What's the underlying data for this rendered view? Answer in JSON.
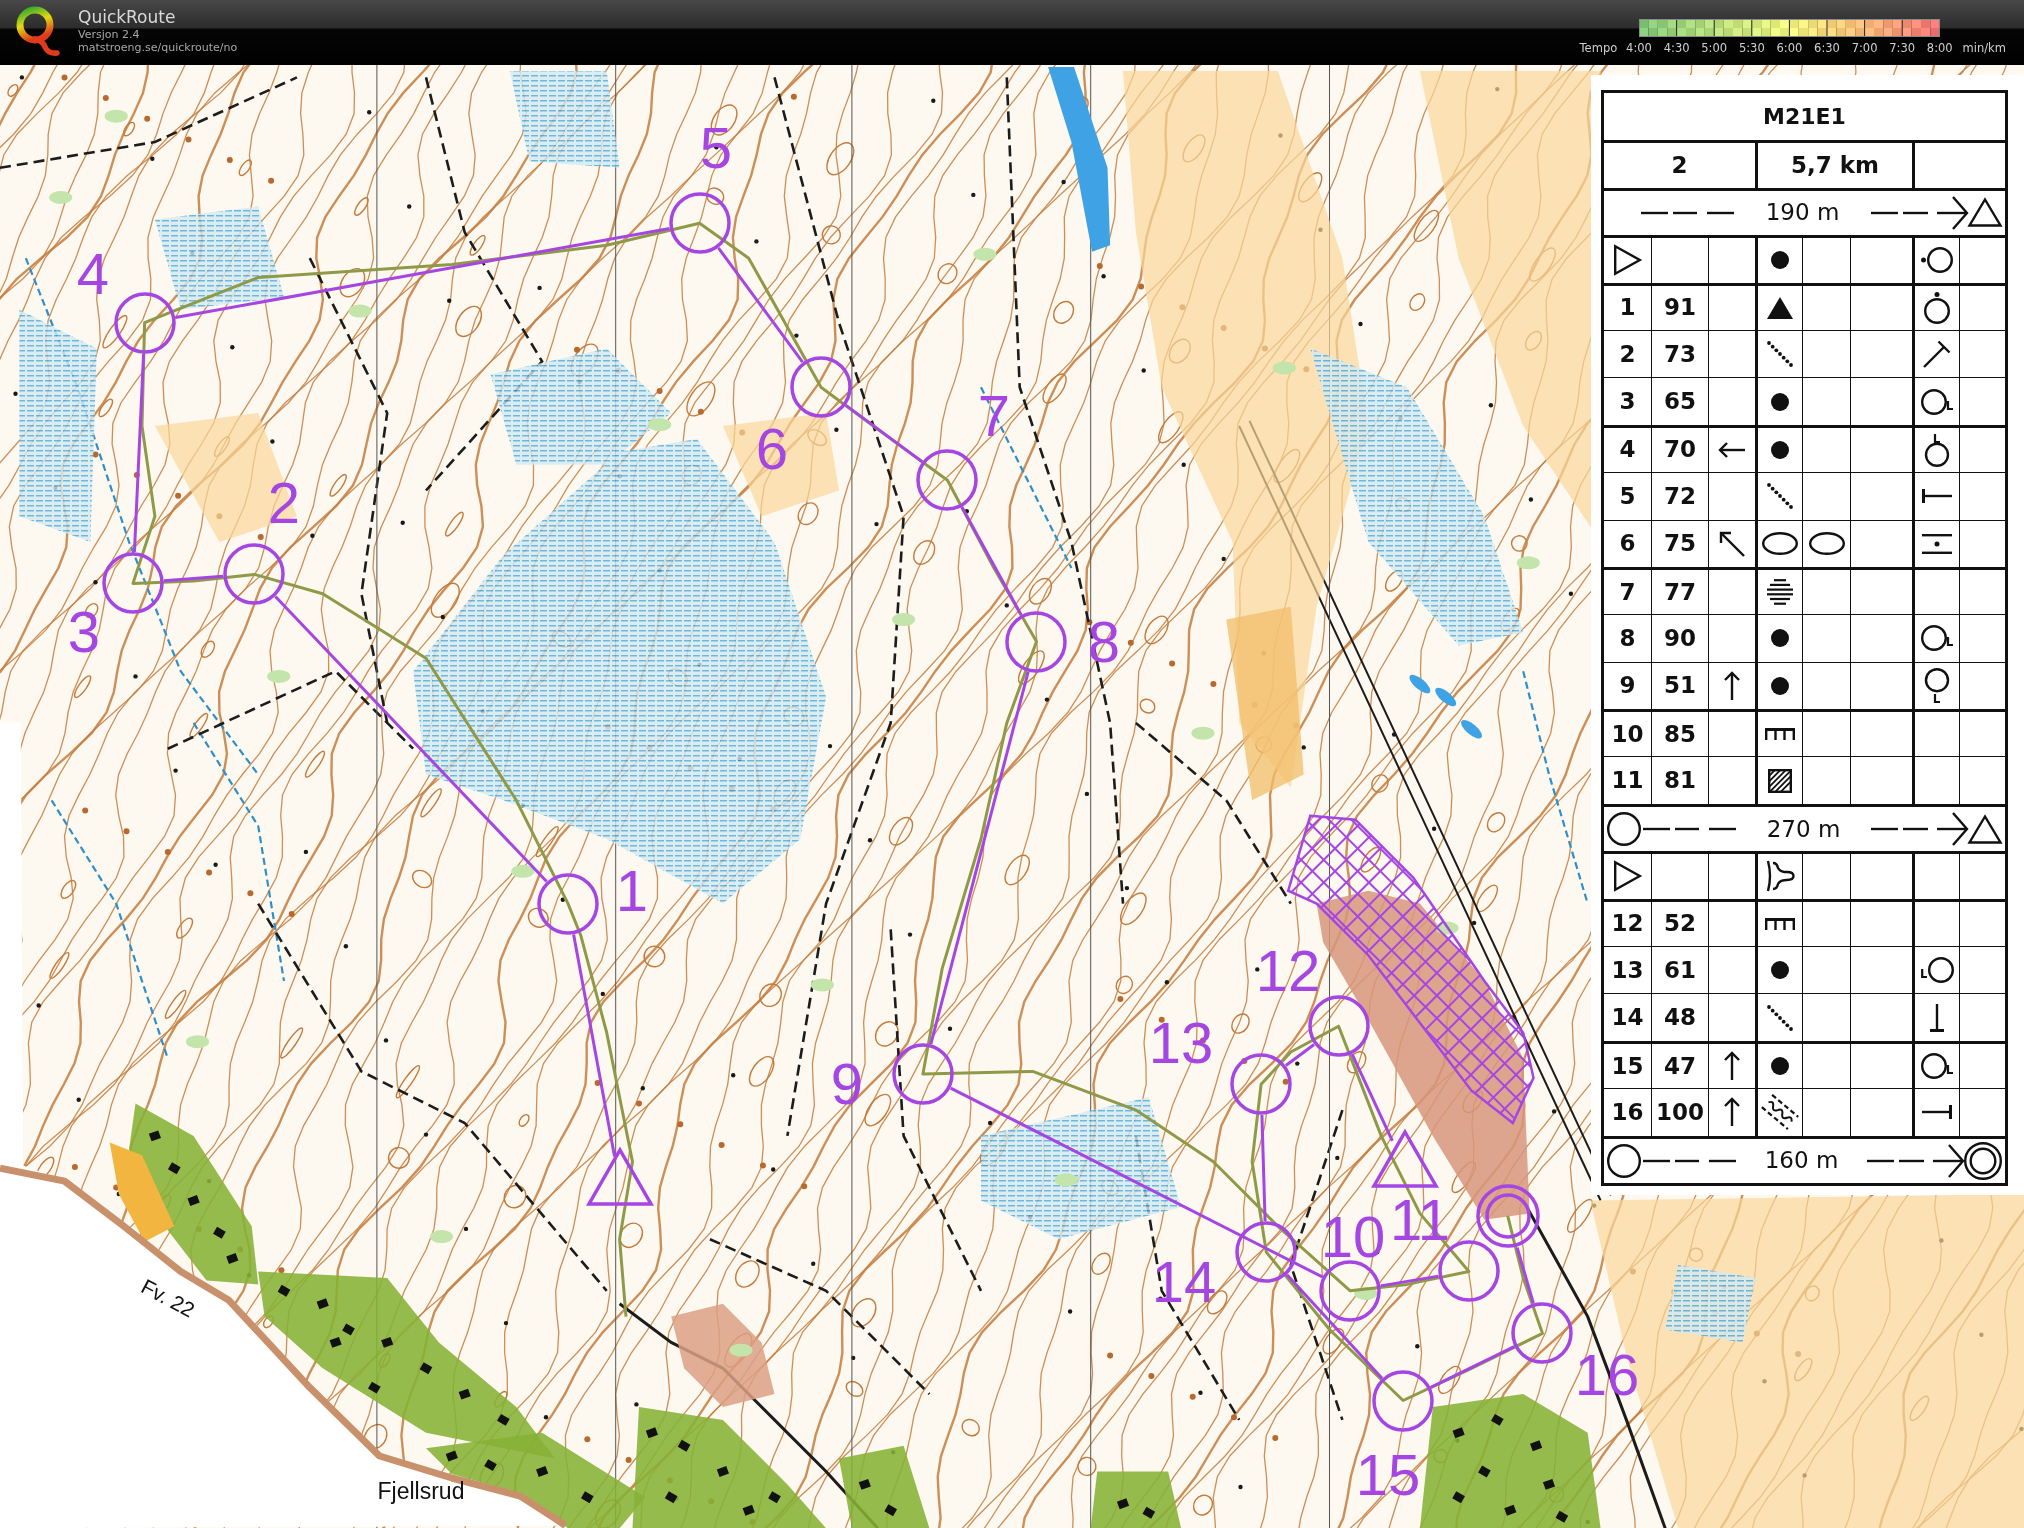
{
  "header": {
    "app_name": "QuickRoute",
    "version": "Versjon 2.4",
    "url": "matstroeng.se/quickroute/no"
  },
  "tempo_scale": {
    "label": "Tempo",
    "ticks": [
      "4:00",
      "4:30",
      "5:00",
      "5:30",
      "6:00",
      "6:30",
      "7:00",
      "7:30",
      "8:00"
    ],
    "unit": "min/km"
  },
  "map": {
    "labels": [
      {
        "kind": "road",
        "text": "Fv. 22"
      },
      {
        "kind": "place",
        "text": "Fjellsrud"
      }
    ],
    "course": [
      {
        "kind": "start"
      },
      {
        "kind": "control",
        "number": "1"
      },
      {
        "kind": "control",
        "number": "2"
      },
      {
        "kind": "control",
        "number": "3"
      },
      {
        "kind": "control",
        "number": "4"
      },
      {
        "kind": "control",
        "number": "5"
      },
      {
        "kind": "control",
        "number": "6"
      },
      {
        "kind": "control",
        "number": "7"
      },
      {
        "kind": "control",
        "number": "8"
      },
      {
        "kind": "control",
        "number": "9"
      },
      {
        "kind": "control",
        "number": "10"
      },
      {
        "kind": "control",
        "number": "11"
      },
      {
        "kind": "start"
      },
      {
        "kind": "control",
        "number": "12"
      },
      {
        "kind": "control",
        "number": "13"
      },
      {
        "kind": "control",
        "number": "14"
      },
      {
        "kind": "control",
        "number": "15"
      },
      {
        "kind": "control",
        "number": "16"
      },
      {
        "kind": "finish"
      }
    ]
  },
  "description": {
    "title": "M21E1",
    "info": [
      "2",
      "5,7 km"
    ],
    "rows": [
      {
        "kind": "startroute",
        "distance": "190 m"
      },
      {
        "kind": "start",
        "symbols": [
          {
            "kind": "blank"
          },
          {
            "kind": "dot"
          },
          {
            "kind": "blank"
          },
          {
            "kind": "blank"
          },
          {
            "kind": "westside"
          },
          {
            "kind": "blank"
          }
        ]
      },
      {
        "kind": "control",
        "number": "1",
        "code": "91",
        "symbols": [
          {
            "kind": "blank"
          },
          {
            "kind": "triangle"
          },
          {
            "kind": "blank"
          },
          {
            "kind": "blank"
          },
          {
            "kind": "northside"
          },
          {
            "kind": "blank"
          }
        ]
      },
      {
        "kind": "control",
        "number": "2",
        "code": "73",
        "symbols": [
          {
            "kind": "blank"
          },
          {
            "kind": "dotted"
          },
          {
            "kind": "blank"
          },
          {
            "kind": "blank"
          },
          {
            "kind": "northeastend"
          },
          {
            "kind": "blank"
          }
        ]
      },
      {
        "kind": "control",
        "number": "3",
        "code": "65",
        "symbols": [
          {
            "kind": "blank"
          },
          {
            "kind": "dot"
          },
          {
            "kind": "blank"
          },
          {
            "kind": "blank"
          },
          {
            "kind": "eastfoot"
          },
          {
            "kind": "blank"
          }
        ]
      },
      {
        "kind": "control",
        "number": "4",
        "code": "70",
        "symbols": [
          {
            "kind": "west"
          },
          {
            "kind": "dot"
          },
          {
            "kind": "blank"
          },
          {
            "kind": "blank"
          },
          {
            "kind": "northfoot"
          },
          {
            "kind": "blank"
          }
        ]
      },
      {
        "kind": "control",
        "number": "5",
        "code": "72",
        "symbols": [
          {
            "kind": "blank"
          },
          {
            "kind": "dotted"
          },
          {
            "kind": "blank"
          },
          {
            "kind": "blank"
          },
          {
            "kind": "westend"
          },
          {
            "kind": "blank"
          }
        ]
      },
      {
        "kind": "control",
        "number": "6",
        "code": "75",
        "symbols": [
          {
            "kind": "northwest"
          },
          {
            "kind": "ellipse"
          },
          {
            "kind": "ellipse"
          },
          {
            "kind": "blank"
          },
          {
            "kind": "between"
          },
          {
            "kind": "blank"
          }
        ]
      },
      {
        "kind": "control",
        "number": "7",
        "code": "77",
        "symbols": [
          {
            "kind": "blank"
          },
          {
            "kind": "bars"
          },
          {
            "kind": "blank"
          },
          {
            "kind": "blank"
          },
          {
            "kind": "blank"
          },
          {
            "kind": "blank"
          }
        ]
      },
      {
        "kind": "control",
        "number": "8",
        "code": "90",
        "symbols": [
          {
            "kind": "blank"
          },
          {
            "kind": "dot"
          },
          {
            "kind": "blank"
          },
          {
            "kind": "blank"
          },
          {
            "kind": "eastfoot"
          },
          {
            "kind": "blank"
          }
        ]
      },
      {
        "kind": "control",
        "number": "9",
        "code": "51",
        "symbols": [
          {
            "kind": "north"
          },
          {
            "kind": "dot"
          },
          {
            "kind": "blank"
          },
          {
            "kind": "blank"
          },
          {
            "kind": "southfoot"
          },
          {
            "kind": "blank"
          }
        ]
      },
      {
        "kind": "control",
        "number": "10",
        "code": "85",
        "symbols": [
          {
            "kind": "blank"
          },
          {
            "kind": "comb"
          },
          {
            "kind": "blank"
          },
          {
            "kind": "blank"
          },
          {
            "kind": "blank"
          },
          {
            "kind": "blank"
          }
        ]
      },
      {
        "kind": "control",
        "number": "11",
        "code": "81",
        "symbols": [
          {
            "kind": "blank"
          },
          {
            "kind": "hatched"
          },
          {
            "kind": "blank"
          },
          {
            "kind": "blank"
          },
          {
            "kind": "blank"
          },
          {
            "kind": "blank"
          }
        ]
      },
      {
        "kind": "exchangeroute",
        "distance": "270 m"
      },
      {
        "kind": "start",
        "symbols": [
          {
            "kind": "blank"
          },
          {
            "kind": "spur"
          },
          {
            "kind": "blank"
          },
          {
            "kind": "blank"
          },
          {
            "kind": "blank"
          },
          {
            "kind": "blank"
          }
        ]
      },
      {
        "kind": "control",
        "number": "12",
        "code": "52",
        "symbols": [
          {
            "kind": "blank"
          },
          {
            "kind": "comb"
          },
          {
            "kind": "blank"
          },
          {
            "kind": "blank"
          },
          {
            "kind": "blank"
          },
          {
            "kind": "blank"
          }
        ]
      },
      {
        "kind": "control",
        "number": "13",
        "code": "61",
        "symbols": [
          {
            "kind": "blank"
          },
          {
            "kind": "dot"
          },
          {
            "kind": "blank"
          },
          {
            "kind": "blank"
          },
          {
            "kind": "westfoot"
          },
          {
            "kind": "blank"
          }
        ]
      },
      {
        "kind": "control",
        "number": "14",
        "code": "48",
        "symbols": [
          {
            "kind": "blank"
          },
          {
            "kind": "dotted"
          },
          {
            "kind": "blank"
          },
          {
            "kind": "blank"
          },
          {
            "kind": "southend"
          },
          {
            "kind": "blank"
          }
        ]
      },
      {
        "kind": "control",
        "number": "15",
        "code": "47",
        "symbols": [
          {
            "kind": "north"
          },
          {
            "kind": "dot"
          },
          {
            "kind": "blank"
          },
          {
            "kind": "blank"
          },
          {
            "kind": "eastfoot"
          },
          {
            "kind": "blank"
          }
        ]
      },
      {
        "kind": "control",
        "number": "16",
        "code": "100",
        "symbols": [
          {
            "kind": "north"
          },
          {
            "kind": "wavy"
          },
          {
            "kind": "blank"
          },
          {
            "kind": "blank"
          },
          {
            "kind": "eastend"
          },
          {
            "kind": "blank"
          }
        ]
      },
      {
        "kind": "finishroute",
        "distance": "160 m"
      }
    ]
  }
}
